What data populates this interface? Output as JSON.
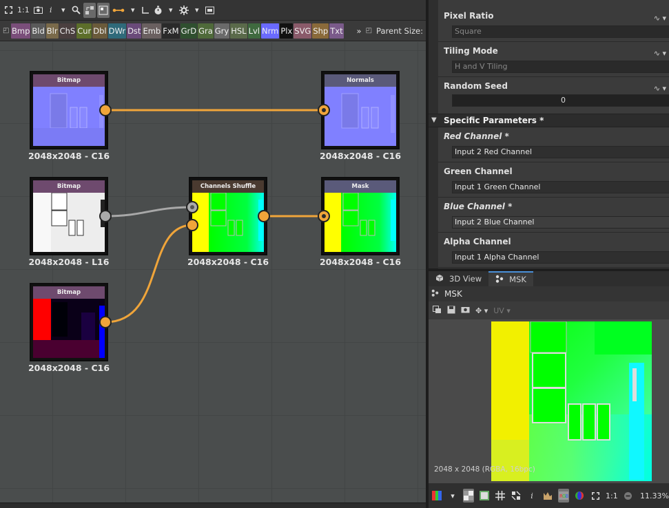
{
  "graph_toolbar": {
    "items": [
      "fit-icon",
      "1:1",
      "screenshot-icon",
      "i",
      "▾",
      "search-icon",
      "align-icon",
      "layout-icon",
      "link-icon",
      "▾",
      "frame-icon",
      "timer-icon",
      "▾",
      "gear-icon",
      "▾",
      "display-icon"
    ],
    "ratio_label": "1:1",
    "info_label": "i"
  },
  "library_bar": {
    "chips": [
      {
        "label": "Bmp",
        "color": "#7a4e7a"
      },
      {
        "label": "Bld",
        "color": "#5a5a5a"
      },
      {
        "label": "Blr",
        "color": "#7a6a4a"
      },
      {
        "label": "ChS",
        "color": "#4a3f3f"
      },
      {
        "label": "Cur",
        "color": "#5c6e2a"
      },
      {
        "label": "Dbl",
        "color": "#6a5a3a"
      },
      {
        "label": "DWr",
        "color": "#2f6a7a"
      },
      {
        "label": "Dst",
        "color": "#6a4a7a"
      },
      {
        "label": "Emb",
        "color": "#6a6060"
      },
      {
        "label": "FxM",
        "color": "#2a2a2a"
      },
      {
        "label": "GrD",
        "color": "#2f4f2f"
      },
      {
        "label": "Gra",
        "color": "#4f6a3a"
      },
      {
        "label": "Gry",
        "color": "#6a6a6a"
      },
      {
        "label": "HSL",
        "color": "#5a6a4a"
      },
      {
        "label": "Lvl",
        "color": "#3f6a3f"
      },
      {
        "label": "Nrm",
        "color": "#6a6aff"
      },
      {
        "label": "Plx",
        "color": "#111111"
      },
      {
        "label": "SVG",
        "color": "#8a5a6a"
      },
      {
        "label": "Shp",
        "color": "#8a6a3a"
      },
      {
        "label": "Txt",
        "color": "#7a5a8a"
      }
    ],
    "more": "»",
    "parent_size_label": "Parent Size:"
  },
  "nodes": [
    {
      "id": "bitmap-1",
      "title": "Bitmap",
      "header_color": "#6e4a6e",
      "label": "2048x2048 - C16",
      "thumb": "normal"
    },
    {
      "id": "normals",
      "title": "Normals",
      "header_color": "#5a5a7a",
      "label": "2048x2048 - C16",
      "thumb": "normal"
    },
    {
      "id": "bitmap-2",
      "title": "Bitmap",
      "header_color": "#6e4a6e",
      "label": "2048x2048 - L16",
      "thumb": "gray"
    },
    {
      "id": "channels-shuffle",
      "title": "Channels Shuffle",
      "header_color": "#4a3a30",
      "label": "2048x2048 - C16",
      "thumb": "msk"
    },
    {
      "id": "mask",
      "title": "Mask",
      "header_color": "#5a5a7a",
      "label": "2048x2048 - C16",
      "thumb": "msk"
    },
    {
      "id": "bitmap-3",
      "title": "Bitmap",
      "header_color": "#6e4a6e",
      "label": "2048x2048 - C16",
      "thumb": "redblue"
    }
  ],
  "properties": {
    "pixel_ratio": {
      "label": "Pixel Ratio",
      "value": "Square"
    },
    "tiling_mode": {
      "label": "Tiling Mode",
      "value": "H and V Tiling"
    },
    "random_seed": {
      "label": "Random Seed",
      "value": "0"
    },
    "section_title": "Specific Parameters *",
    "red_channel": {
      "label": "Red Channel *",
      "value": "Input 2 Red Channel"
    },
    "green_channel": {
      "label": "Green Channel",
      "value": "Input 1 Green Channel"
    },
    "blue_channel": {
      "label": "Blue Channel *",
      "value": "Input 2 Blue Channel"
    },
    "alpha_channel": {
      "label": "Alpha Channel",
      "value": "Input 1 Alpha Channel"
    }
  },
  "viewer": {
    "tabs": [
      {
        "label": "3D View",
        "icon": "cube-icon",
        "active": false
      },
      {
        "label": "MSK",
        "icon": "node-icon",
        "active": true
      }
    ],
    "title": "MSK",
    "uv_label": "UV",
    "resolution_text": "2048 x 2048 (RGBA, 16bpc)",
    "bottom_ratio": "1:1",
    "bottom_info": "i",
    "zoom": "11.33%"
  },
  "colors": {
    "wire_orange": "#f0a53a",
    "wire_gray": "#a8a8a8",
    "accent_blue": "#4a90d9"
  }
}
